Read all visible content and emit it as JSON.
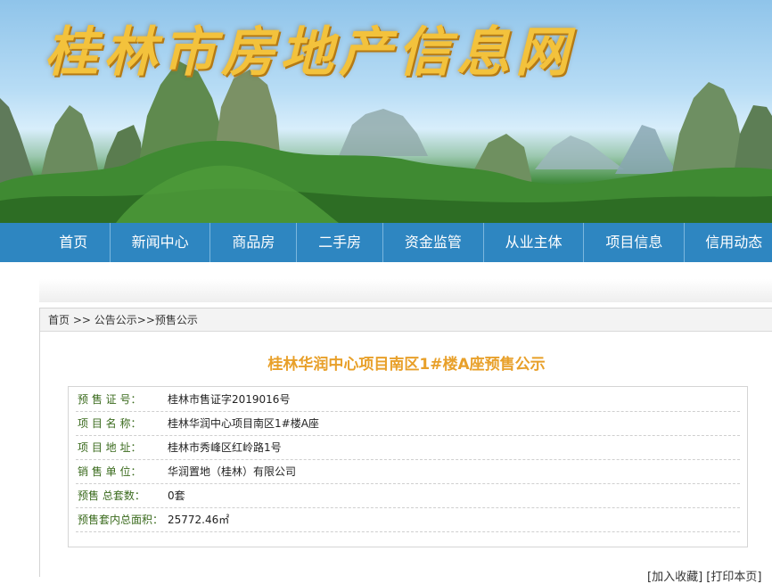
{
  "site_title": "桂林市房地产信息网",
  "nav": [
    "首页",
    "新闻中心",
    "商品房",
    "二手房",
    "资金监管",
    "从业主体",
    "项目信息",
    "信用动态"
  ],
  "breadcrumb": [
    "首页",
    ">>",
    "公告公示>>",
    "预售公示"
  ],
  "page_title": "桂林华润中心项目南区1#楼A座预售公示",
  "fields": [
    {
      "label": "预 售 证 号：",
      "value": "桂林市售证字2019016号"
    },
    {
      "label": "项 目 名 称：",
      "value": "桂林华润中心项目南区1#楼A座"
    },
    {
      "label": "项 目 地 址：",
      "value": "桂林市秀峰区红岭路1号"
    },
    {
      "label": "销 售 单 位：",
      "value": "华润置地（桂林）有限公司"
    },
    {
      "label": "预售 总套数：",
      "value": "0套"
    },
    {
      "label": "预售套内总面积：",
      "value": "25772.46㎡"
    }
  ],
  "footer_links": [
    "[加入收藏]",
    "[打印本页]"
  ],
  "colors": {
    "nav_bg": "#2e86c1",
    "title": "#e8a02a",
    "label": "#3b6b1e",
    "logo": "#f3c23c"
  }
}
